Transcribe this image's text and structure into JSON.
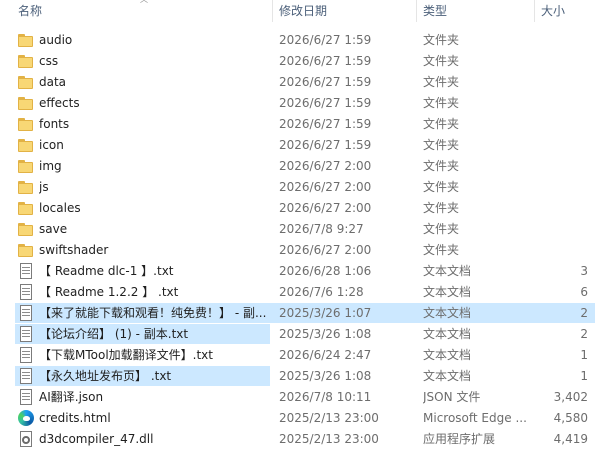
{
  "header": {
    "name": "名称",
    "date": "修改日期",
    "type": "类型",
    "size": "大小"
  },
  "rows": [
    {
      "name": "audio",
      "date": "2026/6/27 1:59",
      "type": "文件夹",
      "size": "",
      "icon": "folder"
    },
    {
      "name": "css",
      "date": "2026/6/27 1:59",
      "type": "文件夹",
      "size": "",
      "icon": "folder"
    },
    {
      "name": "data",
      "date": "2026/6/27 1:59",
      "type": "文件夹",
      "size": "",
      "icon": "folder"
    },
    {
      "name": "effects",
      "date": "2026/6/27 1:59",
      "type": "文件夹",
      "size": "",
      "icon": "folder"
    },
    {
      "name": "fonts",
      "date": "2026/6/27 1:59",
      "type": "文件夹",
      "size": "",
      "icon": "folder"
    },
    {
      "name": "icon",
      "date": "2026/6/27 1:59",
      "type": "文件夹",
      "size": "",
      "icon": "folder"
    },
    {
      "name": "img",
      "date": "2026/6/27 2:00",
      "type": "文件夹",
      "size": "",
      "icon": "folder"
    },
    {
      "name": "js",
      "date": "2026/6/27 2:00",
      "type": "文件夹",
      "size": "",
      "icon": "folder"
    },
    {
      "name": "locales",
      "date": "2026/6/27 2:00",
      "type": "文件夹",
      "size": "",
      "icon": "folder"
    },
    {
      "name": "save",
      "date": "2026/7/8 9:27",
      "type": "文件夹",
      "size": "",
      "icon": "folder"
    },
    {
      "name": "swiftshader",
      "date": "2026/6/27 2:00",
      "type": "文件夹",
      "size": "",
      "icon": "folder"
    },
    {
      "name": "【 Readme  dlc-1 】.txt",
      "date": "2026/6/28 1:06",
      "type": "文本文档",
      "size": "3",
      "icon": "text"
    },
    {
      "name": "【 Readme 1.2.2 】 .txt",
      "date": "2026/7/6 1:28",
      "type": "文本文档",
      "size": "6",
      "icon": "text"
    },
    {
      "name": "【来了就能下载和观看！纯免费！】 - 副...",
      "date": "2025/3/26 1:07",
      "type": "文本文档",
      "size": "2",
      "icon": "text",
      "selected": "full"
    },
    {
      "name": "【论坛介绍】  (1) - 副本.txt",
      "date": "2025/3/26 1:08",
      "type": "文本文档",
      "size": "2",
      "icon": "text",
      "selected": "part"
    },
    {
      "name": "【下载MTool加载翻译文件】.txt",
      "date": "2026/6/24 2:47",
      "type": "文本文档",
      "size": "1",
      "icon": "text"
    },
    {
      "name": "【永久地址发布页】 .txt",
      "date": "2025/3/26 1:08",
      "type": "文本文档",
      "size": "1",
      "icon": "text",
      "selected": "part"
    },
    {
      "name": "AI翻译.json",
      "date": "2026/7/8 10:11",
      "type": "JSON 文件",
      "size": "3,402",
      "icon": "json"
    },
    {
      "name": "credits.html",
      "date": "2025/2/13 23:00",
      "type": "Microsoft Edge ...",
      "size": "4,580",
      "icon": "edge"
    },
    {
      "name": "d3dcompiler_47.dll",
      "date": "2025/2/13 23:00",
      "type": "应用程序扩展",
      "size": "4,419",
      "icon": "dll"
    }
  ]
}
